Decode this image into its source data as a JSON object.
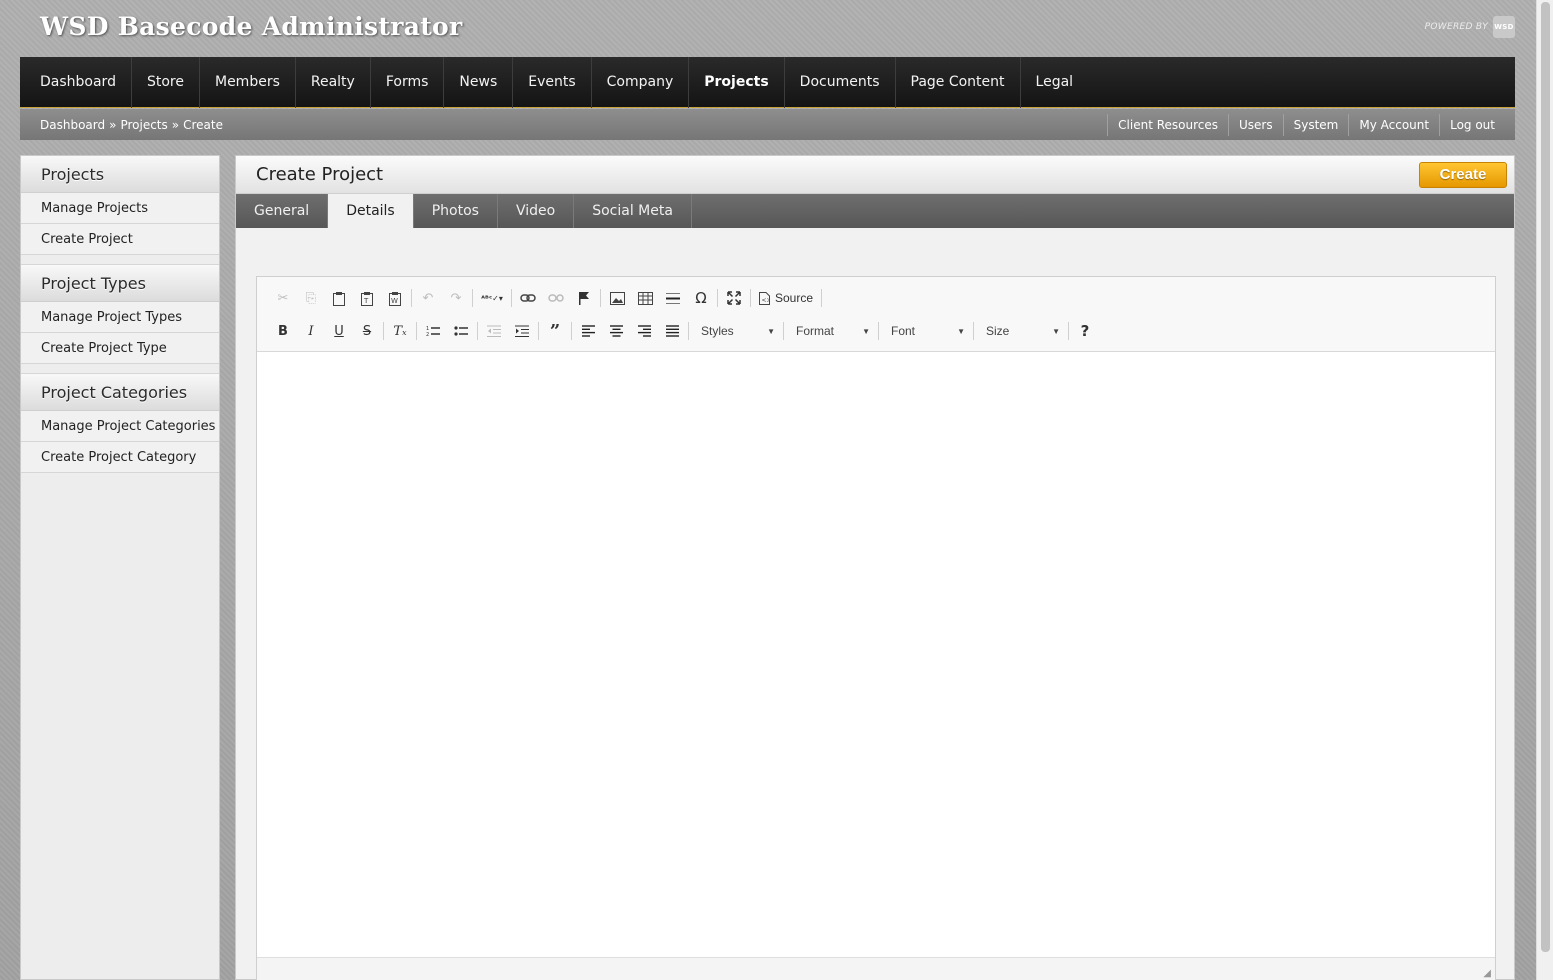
{
  "app": {
    "title": "WSD Basecode Administrator",
    "powered_by": "POWERED BY",
    "logo_text": "WSD"
  },
  "main_nav": [
    {
      "label": "Dashboard"
    },
    {
      "label": "Store"
    },
    {
      "label": "Members"
    },
    {
      "label": "Realty"
    },
    {
      "label": "Forms"
    },
    {
      "label": "News"
    },
    {
      "label": "Events"
    },
    {
      "label": "Company"
    },
    {
      "label": "Projects",
      "active": true
    },
    {
      "label": "Documents"
    },
    {
      "label": "Page Content"
    },
    {
      "label": "Legal"
    }
  ],
  "breadcrumb": {
    "items": [
      "Dashboard",
      "Projects",
      "Create"
    ],
    "separator": "»"
  },
  "util_links": [
    "Client Resources",
    "Users",
    "System",
    "My Account",
    "Log out"
  ],
  "sidebar": {
    "sections": [
      {
        "title": "Projects",
        "items": [
          "Manage Projects",
          "Create Project"
        ]
      },
      {
        "title": "Project Types",
        "items": [
          "Manage Project Types",
          "Create Project Type"
        ]
      },
      {
        "title": "Project Categories",
        "items": [
          "Manage Project Categories",
          "Create Project Category"
        ]
      }
    ]
  },
  "panel": {
    "title": "Create Project",
    "create_label": "Create",
    "tabs": [
      {
        "label": "General"
      },
      {
        "label": "Details",
        "active": true
      },
      {
        "label": "Photos"
      },
      {
        "label": "Video"
      },
      {
        "label": "Social Meta"
      }
    ]
  },
  "editor": {
    "source_label": "Source",
    "combos": {
      "styles": "Styles",
      "format": "Format",
      "font": "Font",
      "size": "Size"
    },
    "toolbar_icons": {
      "row1": [
        "cut-icon",
        "copy-icon",
        "paste-icon",
        "paste-text-icon",
        "paste-word-icon",
        "undo-icon",
        "redo-icon",
        "spellcheck-icon",
        "link-icon",
        "unlink-icon",
        "anchor-icon",
        "image-icon",
        "table-icon",
        "horizontal-rule-icon",
        "special-char-icon",
        "maximize-icon",
        "source-icon"
      ],
      "row2": [
        "bold-icon",
        "italic-icon",
        "underline-icon",
        "strikethrough-icon",
        "remove-format-icon",
        "numbered-list-icon",
        "bulleted-list-icon",
        "outdent-icon",
        "indent-icon",
        "blockquote-icon",
        "align-left-icon",
        "align-center-icon",
        "align-right-icon",
        "align-justify-icon",
        "help-icon"
      ]
    }
  },
  "colors": {
    "accent": "#f5a800",
    "nav_bg": "#1e1e1e",
    "nav_border": "#c8a23a"
  }
}
